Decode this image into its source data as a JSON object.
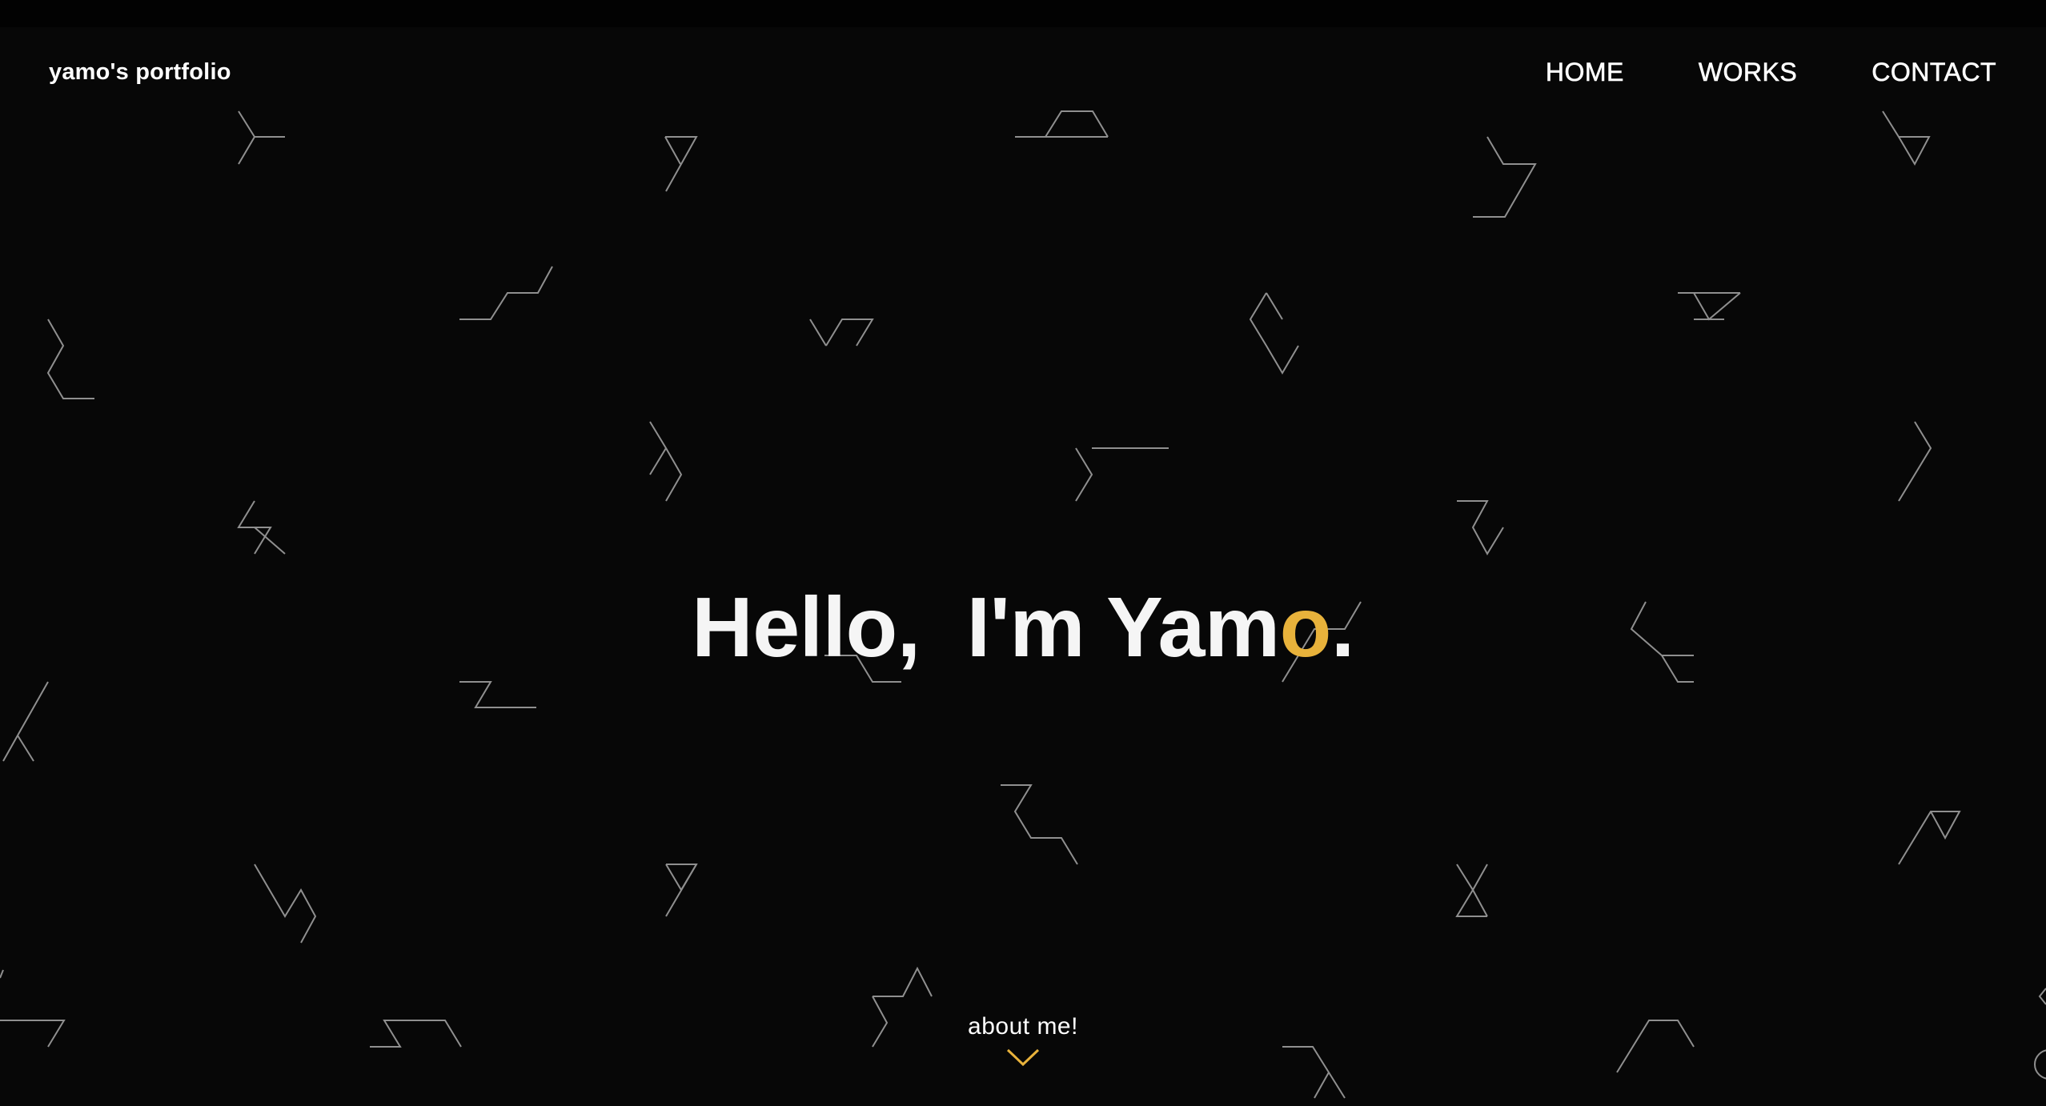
{
  "header": {
    "brand": "yamo's portfolio",
    "nav": [
      {
        "label": "HOME"
      },
      {
        "label": "WORKS"
      },
      {
        "label": "CONTACT"
      }
    ]
  },
  "hero": {
    "greeting": "Hello,",
    "intro_before_accent": "I'm Yam",
    "accent_letter": "o",
    "period": "."
  },
  "scroll_cue": {
    "label": "about me!",
    "icon": "chevron-down-icon"
  },
  "colors": {
    "background": "#070707",
    "text": "#ffffff",
    "accent": "#e8b23b",
    "pattern_stroke": "#8f8f8f"
  }
}
